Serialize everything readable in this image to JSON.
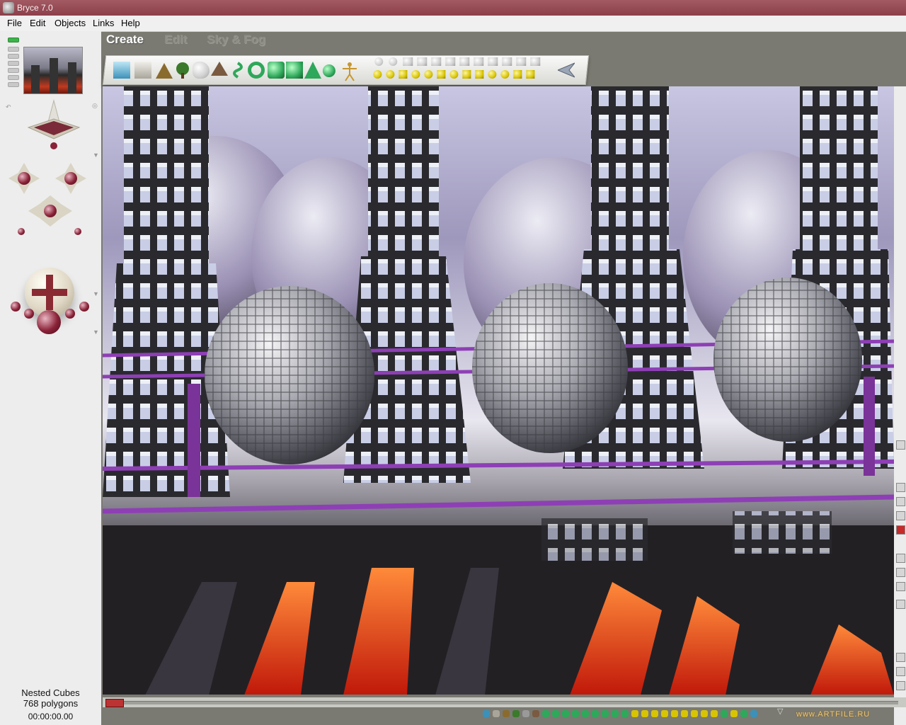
{
  "window": {
    "title": "Bryce 7.0"
  },
  "menu": [
    "File",
    "Edit",
    "Objects",
    "Links",
    "Help"
  ],
  "palette_tabs": [
    {
      "label": "Create",
      "active": true
    },
    {
      "label": "Edit",
      "active": false
    },
    {
      "label": "Sky & Fog",
      "active": false
    }
  ],
  "create_toolbar": {
    "tools": [
      "water-plane-icon",
      "ground-plane-icon",
      "terrain-icon",
      "tree-icon",
      "rock-icon",
      "metaball-icon",
      "torus-icon",
      "cylinder-icon",
      "cube-icon",
      "pyramid-icon",
      "human-figure-icon",
      "sphere-icon",
      "cone-icon",
      "disc-icon",
      "square-icon",
      "light-icon",
      "camera-icon",
      "library-arrow-icon"
    ]
  },
  "left_panel": {
    "object_name": "Nested Cubes",
    "polygon_count": "768 polygons",
    "time": "00:00:00.00"
  },
  "watermark": "www.ARTFILE.RU",
  "colors": {
    "title_bar": "#9a4e58",
    "active_tab": "#ffffff",
    "viewport_sky": "#c8c6e2",
    "accent_purple": "#8e3fb5"
  }
}
